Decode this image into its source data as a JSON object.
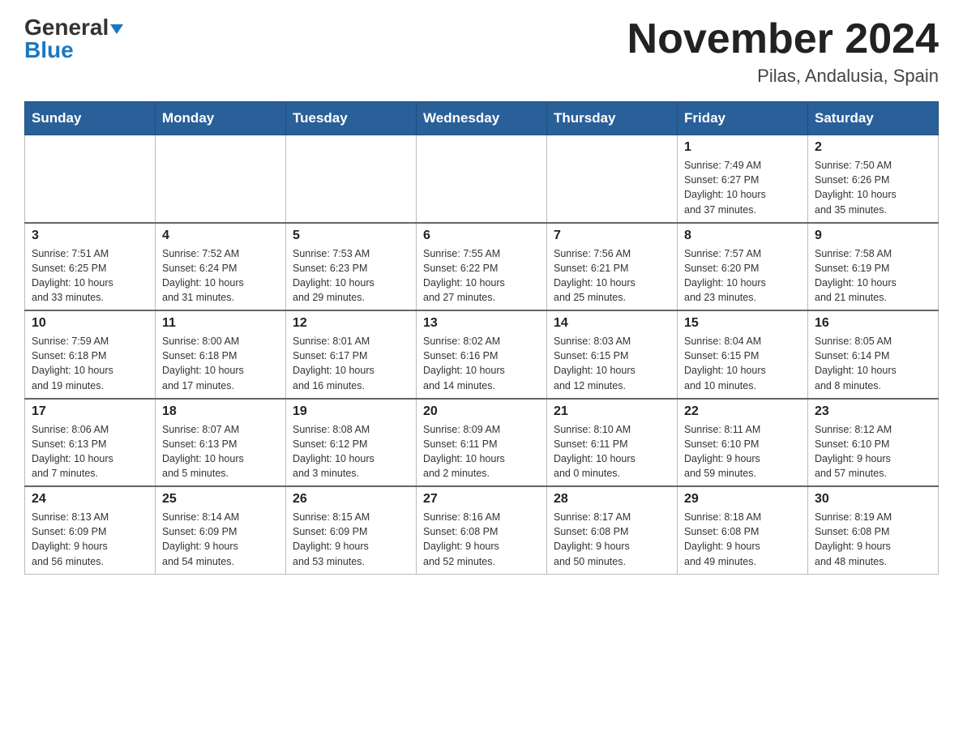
{
  "header": {
    "logo_line1": "General",
    "logo_line2": "Blue",
    "month_title": "November 2024",
    "location": "Pilas, Andalusia, Spain"
  },
  "weekdays": [
    "Sunday",
    "Monday",
    "Tuesday",
    "Wednesday",
    "Thursday",
    "Friday",
    "Saturday"
  ],
  "weeks": [
    [
      {
        "day": "",
        "info": ""
      },
      {
        "day": "",
        "info": ""
      },
      {
        "day": "",
        "info": ""
      },
      {
        "day": "",
        "info": ""
      },
      {
        "day": "",
        "info": ""
      },
      {
        "day": "1",
        "info": "Sunrise: 7:49 AM\nSunset: 6:27 PM\nDaylight: 10 hours\nand 37 minutes."
      },
      {
        "day": "2",
        "info": "Sunrise: 7:50 AM\nSunset: 6:26 PM\nDaylight: 10 hours\nand 35 minutes."
      }
    ],
    [
      {
        "day": "3",
        "info": "Sunrise: 7:51 AM\nSunset: 6:25 PM\nDaylight: 10 hours\nand 33 minutes."
      },
      {
        "day": "4",
        "info": "Sunrise: 7:52 AM\nSunset: 6:24 PM\nDaylight: 10 hours\nand 31 minutes."
      },
      {
        "day": "5",
        "info": "Sunrise: 7:53 AM\nSunset: 6:23 PM\nDaylight: 10 hours\nand 29 minutes."
      },
      {
        "day": "6",
        "info": "Sunrise: 7:55 AM\nSunset: 6:22 PM\nDaylight: 10 hours\nand 27 minutes."
      },
      {
        "day": "7",
        "info": "Sunrise: 7:56 AM\nSunset: 6:21 PM\nDaylight: 10 hours\nand 25 minutes."
      },
      {
        "day": "8",
        "info": "Sunrise: 7:57 AM\nSunset: 6:20 PM\nDaylight: 10 hours\nand 23 minutes."
      },
      {
        "day": "9",
        "info": "Sunrise: 7:58 AM\nSunset: 6:19 PM\nDaylight: 10 hours\nand 21 minutes."
      }
    ],
    [
      {
        "day": "10",
        "info": "Sunrise: 7:59 AM\nSunset: 6:18 PM\nDaylight: 10 hours\nand 19 minutes."
      },
      {
        "day": "11",
        "info": "Sunrise: 8:00 AM\nSunset: 6:18 PM\nDaylight: 10 hours\nand 17 minutes."
      },
      {
        "day": "12",
        "info": "Sunrise: 8:01 AM\nSunset: 6:17 PM\nDaylight: 10 hours\nand 16 minutes."
      },
      {
        "day": "13",
        "info": "Sunrise: 8:02 AM\nSunset: 6:16 PM\nDaylight: 10 hours\nand 14 minutes."
      },
      {
        "day": "14",
        "info": "Sunrise: 8:03 AM\nSunset: 6:15 PM\nDaylight: 10 hours\nand 12 minutes."
      },
      {
        "day": "15",
        "info": "Sunrise: 8:04 AM\nSunset: 6:15 PM\nDaylight: 10 hours\nand 10 minutes."
      },
      {
        "day": "16",
        "info": "Sunrise: 8:05 AM\nSunset: 6:14 PM\nDaylight: 10 hours\nand 8 minutes."
      }
    ],
    [
      {
        "day": "17",
        "info": "Sunrise: 8:06 AM\nSunset: 6:13 PM\nDaylight: 10 hours\nand 7 minutes."
      },
      {
        "day": "18",
        "info": "Sunrise: 8:07 AM\nSunset: 6:13 PM\nDaylight: 10 hours\nand 5 minutes."
      },
      {
        "day": "19",
        "info": "Sunrise: 8:08 AM\nSunset: 6:12 PM\nDaylight: 10 hours\nand 3 minutes."
      },
      {
        "day": "20",
        "info": "Sunrise: 8:09 AM\nSunset: 6:11 PM\nDaylight: 10 hours\nand 2 minutes."
      },
      {
        "day": "21",
        "info": "Sunrise: 8:10 AM\nSunset: 6:11 PM\nDaylight: 10 hours\nand 0 minutes."
      },
      {
        "day": "22",
        "info": "Sunrise: 8:11 AM\nSunset: 6:10 PM\nDaylight: 9 hours\nand 59 minutes."
      },
      {
        "day": "23",
        "info": "Sunrise: 8:12 AM\nSunset: 6:10 PM\nDaylight: 9 hours\nand 57 minutes."
      }
    ],
    [
      {
        "day": "24",
        "info": "Sunrise: 8:13 AM\nSunset: 6:09 PM\nDaylight: 9 hours\nand 56 minutes."
      },
      {
        "day": "25",
        "info": "Sunrise: 8:14 AM\nSunset: 6:09 PM\nDaylight: 9 hours\nand 54 minutes."
      },
      {
        "day": "26",
        "info": "Sunrise: 8:15 AM\nSunset: 6:09 PM\nDaylight: 9 hours\nand 53 minutes."
      },
      {
        "day": "27",
        "info": "Sunrise: 8:16 AM\nSunset: 6:08 PM\nDaylight: 9 hours\nand 52 minutes."
      },
      {
        "day": "28",
        "info": "Sunrise: 8:17 AM\nSunset: 6:08 PM\nDaylight: 9 hours\nand 50 minutes."
      },
      {
        "day": "29",
        "info": "Sunrise: 8:18 AM\nSunset: 6:08 PM\nDaylight: 9 hours\nand 49 minutes."
      },
      {
        "day": "30",
        "info": "Sunrise: 8:19 AM\nSunset: 6:08 PM\nDaylight: 9 hours\nand 48 minutes."
      }
    ]
  ]
}
